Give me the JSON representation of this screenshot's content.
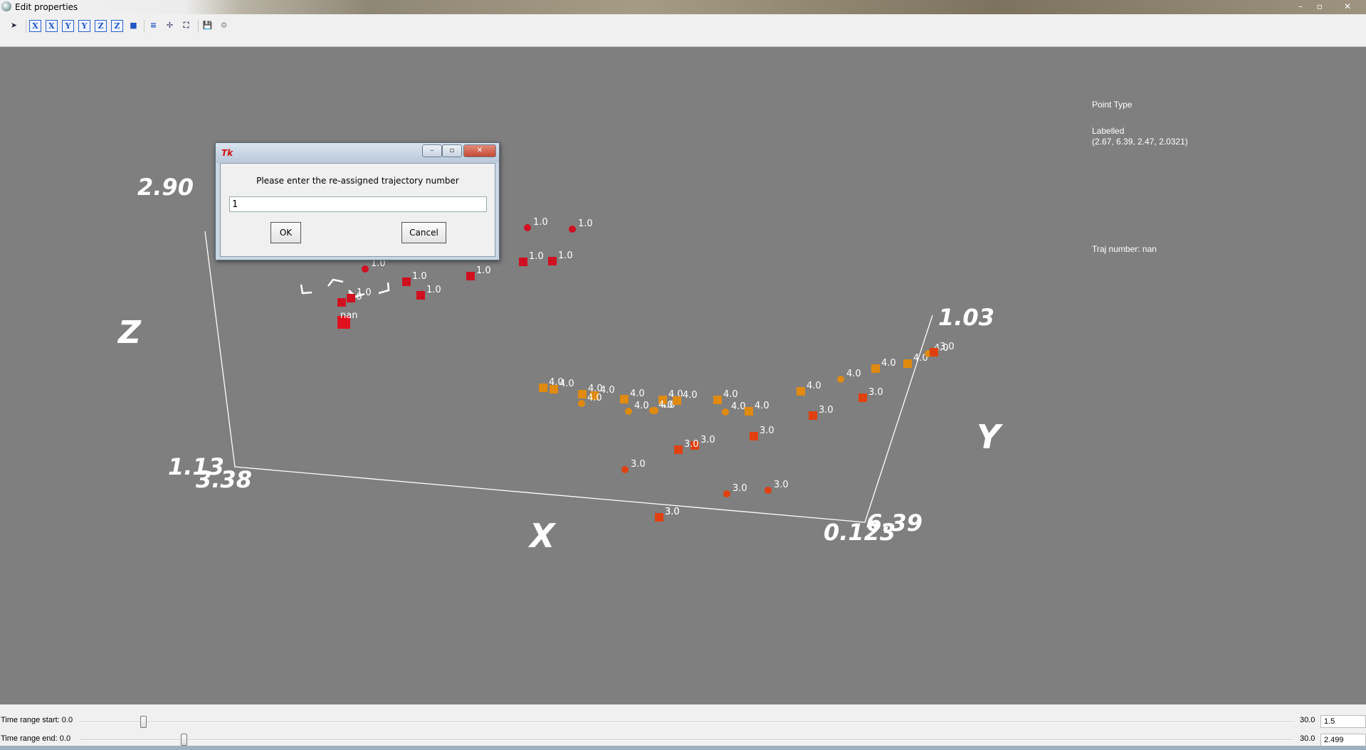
{
  "window": {
    "title": "Edit properties"
  },
  "toolbar": {
    "buttons": [
      {
        "name": "pointer-tool",
        "glyph": "➤"
      },
      {
        "name": "x-axis-button",
        "glyph": "X"
      },
      {
        "name": "x-axis-reverse-button",
        "glyph": "X"
      },
      {
        "name": "y-axis-button",
        "glyph": "Y"
      },
      {
        "name": "y-axis-reverse-button",
        "glyph": "Y"
      },
      {
        "name": "z-axis-button",
        "glyph": "Z"
      },
      {
        "name": "z-axis-reverse-button",
        "glyph": "Z"
      },
      {
        "name": "cube-view-button",
        "glyph": "■"
      },
      {
        "name": "layers-button",
        "glyph": "≡"
      },
      {
        "name": "pan-button",
        "glyph": "✢"
      },
      {
        "name": "fit-view-button",
        "glyph": "⛶"
      },
      {
        "name": "save-button",
        "glyph": "💾"
      },
      {
        "name": "settings-button",
        "glyph": "⚙"
      }
    ]
  },
  "plot": {
    "axis_names": {
      "x": "X",
      "y": "Y",
      "z": "Z"
    },
    "ticks": {
      "z_top": "2.90",
      "z_bottom": "1.13",
      "x_left": "3.38",
      "x_right": "0.123",
      "y_near": "6.39",
      "y_far": "1.03"
    },
    "points": [
      {
        "label": "1.0",
        "color": "#d01020",
        "shape": "sphere"
      },
      {
        "label": "1.0",
        "color": "#d01020",
        "shape": "sphere"
      },
      {
        "label": "1.0",
        "color": "#d01020",
        "shape": "sphere"
      },
      {
        "label": "1.0",
        "color": "#d01020",
        "shape": "cube"
      },
      {
        "label": "1.0",
        "color": "#d01020",
        "shape": "cube"
      },
      {
        "label": "1.0",
        "color": "#d01020",
        "shape": "cube"
      },
      {
        "label": "1.0",
        "color": "#d01020",
        "shape": "cube"
      },
      {
        "label": "1.0",
        "color": "#d01020",
        "shape": "cube"
      },
      {
        "label": "1.0",
        "color": "#d01020",
        "shape": "cube"
      },
      {
        "label": "1.0",
        "color": "#d01020",
        "shape": "cube"
      },
      {
        "label": "nan",
        "color": "#e01020",
        "shape": "cube"
      },
      {
        "label": "4.0",
        "color": "#e08a10",
        "shape": "cube"
      },
      {
        "label": "4.0",
        "color": "#e08a10",
        "shape": "cube"
      },
      {
        "label": "4.0",
        "color": "#e08a10",
        "shape": "cube"
      },
      {
        "label": "4.0",
        "color": "#e08a10",
        "shape": "cube"
      },
      {
        "label": "4.0",
        "color": "#e08a10",
        "shape": "sphere"
      },
      {
        "label": "4.0",
        "color": "#e08a10",
        "shape": "cube"
      },
      {
        "label": "4.0",
        "color": "#e08a10",
        "shape": "sphere"
      },
      {
        "label": "4.0",
        "color": "#e08a10",
        "shape": "sphere"
      },
      {
        "label": "4.0",
        "color": "#e08a10",
        "shape": "cube"
      },
      {
        "label": "4.0",
        "color": "#e08a10",
        "shape": "cube"
      },
      {
        "label": "4.0",
        "color": "#e08a10",
        "shape": "sphere"
      },
      {
        "label": "4.0",
        "color": "#e08a10",
        "shape": "cube"
      },
      {
        "label": "4.0",
        "color": "#e08a10",
        "shape": "sphere"
      },
      {
        "label": "4.0",
        "color": "#e08a10",
        "shape": "cube"
      },
      {
        "label": "4.0",
        "color": "#e08a10",
        "shape": "cube"
      },
      {
        "label": "4.0",
        "color": "#e08a10",
        "shape": "sphere"
      },
      {
        "label": "4.0",
        "color": "#e08a10",
        "shape": "cube"
      },
      {
        "label": "4.0",
        "color": "#e08a10",
        "shape": "cube"
      },
      {
        "label": "4.0",
        "color": "#e08a10",
        "shape": "sphere"
      },
      {
        "label": "3.0",
        "color": "#e04010",
        "shape": "cube"
      },
      {
        "label": "3.0",
        "color": "#e04010",
        "shape": "cube"
      },
      {
        "label": "3.0",
        "color": "#e04010",
        "shape": "cube"
      },
      {
        "label": "3.0",
        "color": "#e04010",
        "shape": "cube"
      },
      {
        "label": "3.0",
        "color": "#e04010",
        "shape": "cube"
      },
      {
        "label": "3.0",
        "color": "#e04010",
        "shape": "cube"
      },
      {
        "label": "3.0",
        "color": "#e04010",
        "shape": "sphere"
      },
      {
        "label": "3.0",
        "color": "#e04010",
        "shape": "sphere"
      },
      {
        "label": "3.0",
        "color": "#e04010",
        "shape": "sphere"
      },
      {
        "label": "3.0",
        "color": "#e04010",
        "shape": "cube"
      },
      {
        "label": "3.0",
        "color": "#e04010",
        "shape": "cube"
      }
    ]
  },
  "info_panel": {
    "point_type_heading": "Point Type",
    "labelled": "Labelled",
    "coords": "(2.67, 6.39, 2.47, 2.0321)",
    "traj": "Traj number: nan"
  },
  "dialog": {
    "prompt": "Please enter the re-assigned trajectory number",
    "value": "1",
    "ok_label": "OK",
    "cancel_label": "Cancel",
    "icon_text": "Tk"
  },
  "time_range": {
    "start_label": "Time range start:",
    "start_min": "0.0",
    "start_max": "30.0",
    "start_value": "1.5",
    "start_fraction": 0.05,
    "end_label": "Time range end:",
    "end_min": "0.0",
    "end_max": "30.0",
    "end_value": "2.499",
    "end_fraction": 0.083
  }
}
